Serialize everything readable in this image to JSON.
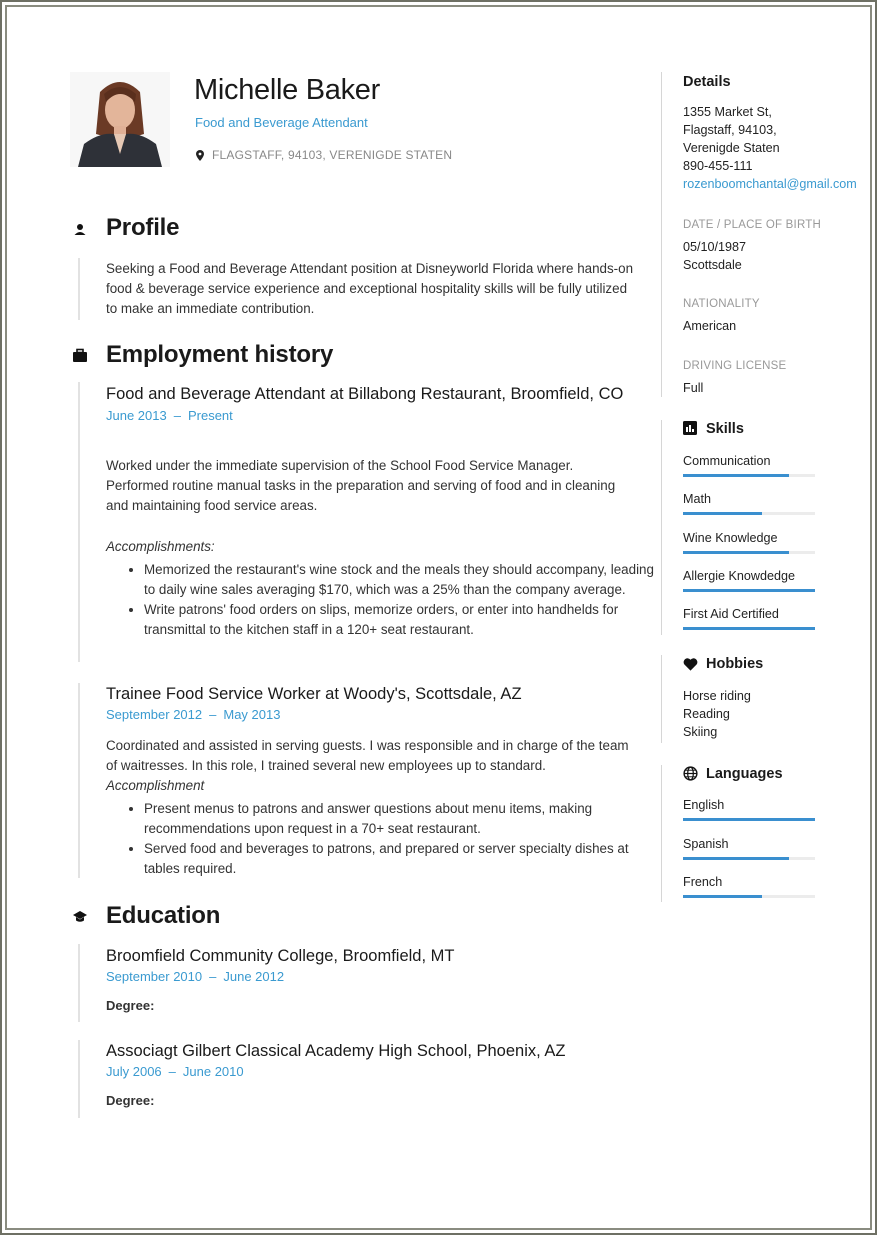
{
  "header": {
    "name": "Michelle Baker",
    "job_title": "Food and Beverage Attendant",
    "location": "FLAGSTAFF, 94103, VERENIGDE STATEN",
    "photo_alt": "Profile photo of Michelle Baker"
  },
  "profile": {
    "heading": "Profile",
    "text": "Seeking a Food and Beverage Attendant position at Disneyworld Florida where hands-on food & beverage service experience and exceptional hospitality skills will be fully utilized to make an immediate contribution."
  },
  "employment": {
    "heading": "Employment history",
    "jobs": [
      {
        "title": "Food and Beverage Attendant at Billabong Restaurant, Broomfield, CO",
        "start": "June 2013",
        "end": "Present",
        "description": "Worked under the immediate supervision of the School Food Service Manager. Performed routine manual tasks in the preparation and serving of food and in cleaning and maintaining food service areas.",
        "accomplishments_label": "Accomplishments:",
        "accomplishments": [
          "Memorized the restaurant's wine stock and the meals they should accompany, leading to daily wine sales averaging $170, which was a 25% than the company average.",
          "Write patrons' food orders on slips, memorize orders, or enter into handhelds for transmittal to the kitchen staff in a 120+ seat restaurant."
        ]
      },
      {
        "title": "Trainee Food Service Worker at Woody's, Scottsdale, AZ",
        "start": "September 2012",
        "end": "May 2013",
        "description": "Coordinated and assisted in serving guests. I was responsible and in charge of the team of waitresses. In this role, I trained several new employees up to standard.",
        "accomplishments_label": "Accomplishment",
        "accomplishments": [
          "Present menus to patrons and answer questions about menu items, making recommendations upon request in a 70+ seat restaurant.",
          "Served food and beverages to patrons, and prepared or server specialty dishes at tables required."
        ]
      }
    ]
  },
  "education": {
    "heading": "Education",
    "schools": [
      {
        "title": "Broomfield Community College, Broomfield, MT",
        "start": "September 2010",
        "end": "June 2012",
        "degree_label": "Degree:"
      },
      {
        "title": "Associagt Gilbert Classical Academy High School, Phoenix, AZ",
        "start": "July 2006",
        "end": "June 2010",
        "degree_label": "Degree:"
      }
    ]
  },
  "date_separator": "–",
  "sidebar": {
    "details": {
      "heading": "Details",
      "address_lines": [
        "1355 Market St,",
        "Flagstaff, 94103,",
        "Verenigde Staten"
      ],
      "phone": "890-455-111",
      "email": "rozenboomchantal@gmail.com",
      "birth_label": "DATE / PLACE OF BIRTH",
      "birth_date": "05/10/1987",
      "birth_place": "Scottsdale",
      "nationality_label": "NATIONALITY",
      "nationality": "American",
      "license_label": "DRIVING LICENSE",
      "license": "Full"
    },
    "skills": {
      "heading": "Skills",
      "items": [
        {
          "name": "Communication",
          "level": 0.8
        },
        {
          "name": "Math",
          "level": 0.6
        },
        {
          "name": "Wine Knowledge",
          "level": 0.8
        },
        {
          "name": "Allergie Knowdedge",
          "level": 1.0
        },
        {
          "name": "First Aid Certified",
          "level": 1.0
        }
      ]
    },
    "hobbies": {
      "heading": "Hobbies",
      "items": [
        "Horse riding",
        "Reading",
        "Skiing"
      ]
    },
    "languages": {
      "heading": "Languages",
      "items": [
        {
          "name": "English",
          "level": 1.0
        },
        {
          "name": "Spanish",
          "level": 0.8
        },
        {
          "name": "French",
          "level": 0.6
        }
      ]
    }
  },
  "colors": {
    "accent": "#3a9ad0",
    "bar": "#3a8fcf",
    "muted": "#999999"
  }
}
